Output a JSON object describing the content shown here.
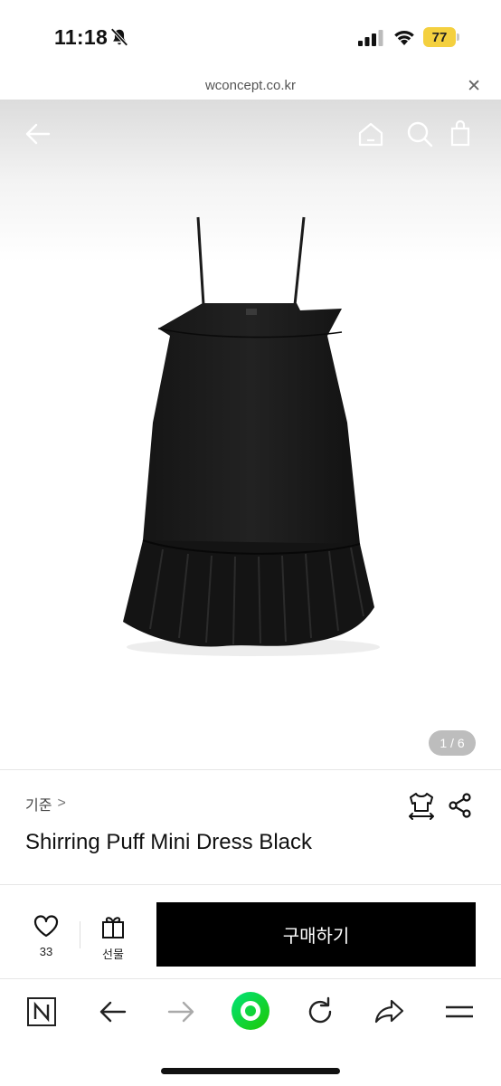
{
  "status_bar": {
    "time": "11:18",
    "battery": "77",
    "battery_color": "#f4d03f",
    "icons": [
      "bell-slash-icon",
      "signal-icon",
      "wifi-icon",
      "battery-icon"
    ]
  },
  "url_bar": {
    "url": "wconcept.co.kr",
    "close_icon": "close-icon"
  },
  "header": {
    "back_icon": "back-arrow-icon",
    "home_icon": "home-icon",
    "search_icon": "search-icon",
    "cart_icon": "shopping-bag-icon",
    "cart_count": "0"
  },
  "gallery": {
    "image": "black-mini-dress",
    "counter": "1 / 6"
  },
  "product": {
    "brand": "기준",
    "brand_chevron": ">",
    "title": "Shirring Puff Mini Dress Black",
    "fit_icon": "size-fit-icon",
    "share_icon": "share-icon"
  },
  "actions": {
    "like_count": "33",
    "gift_label": "선물",
    "buy_label": "구매하기",
    "buy_color": "#000000"
  },
  "browser_toolbar": {
    "items": [
      "naver-n-icon",
      "back-icon",
      "forward-icon",
      "green-home-icon",
      "reload-icon",
      "share-arrow-icon",
      "menu-icon"
    ],
    "accent": "#1ec800"
  }
}
